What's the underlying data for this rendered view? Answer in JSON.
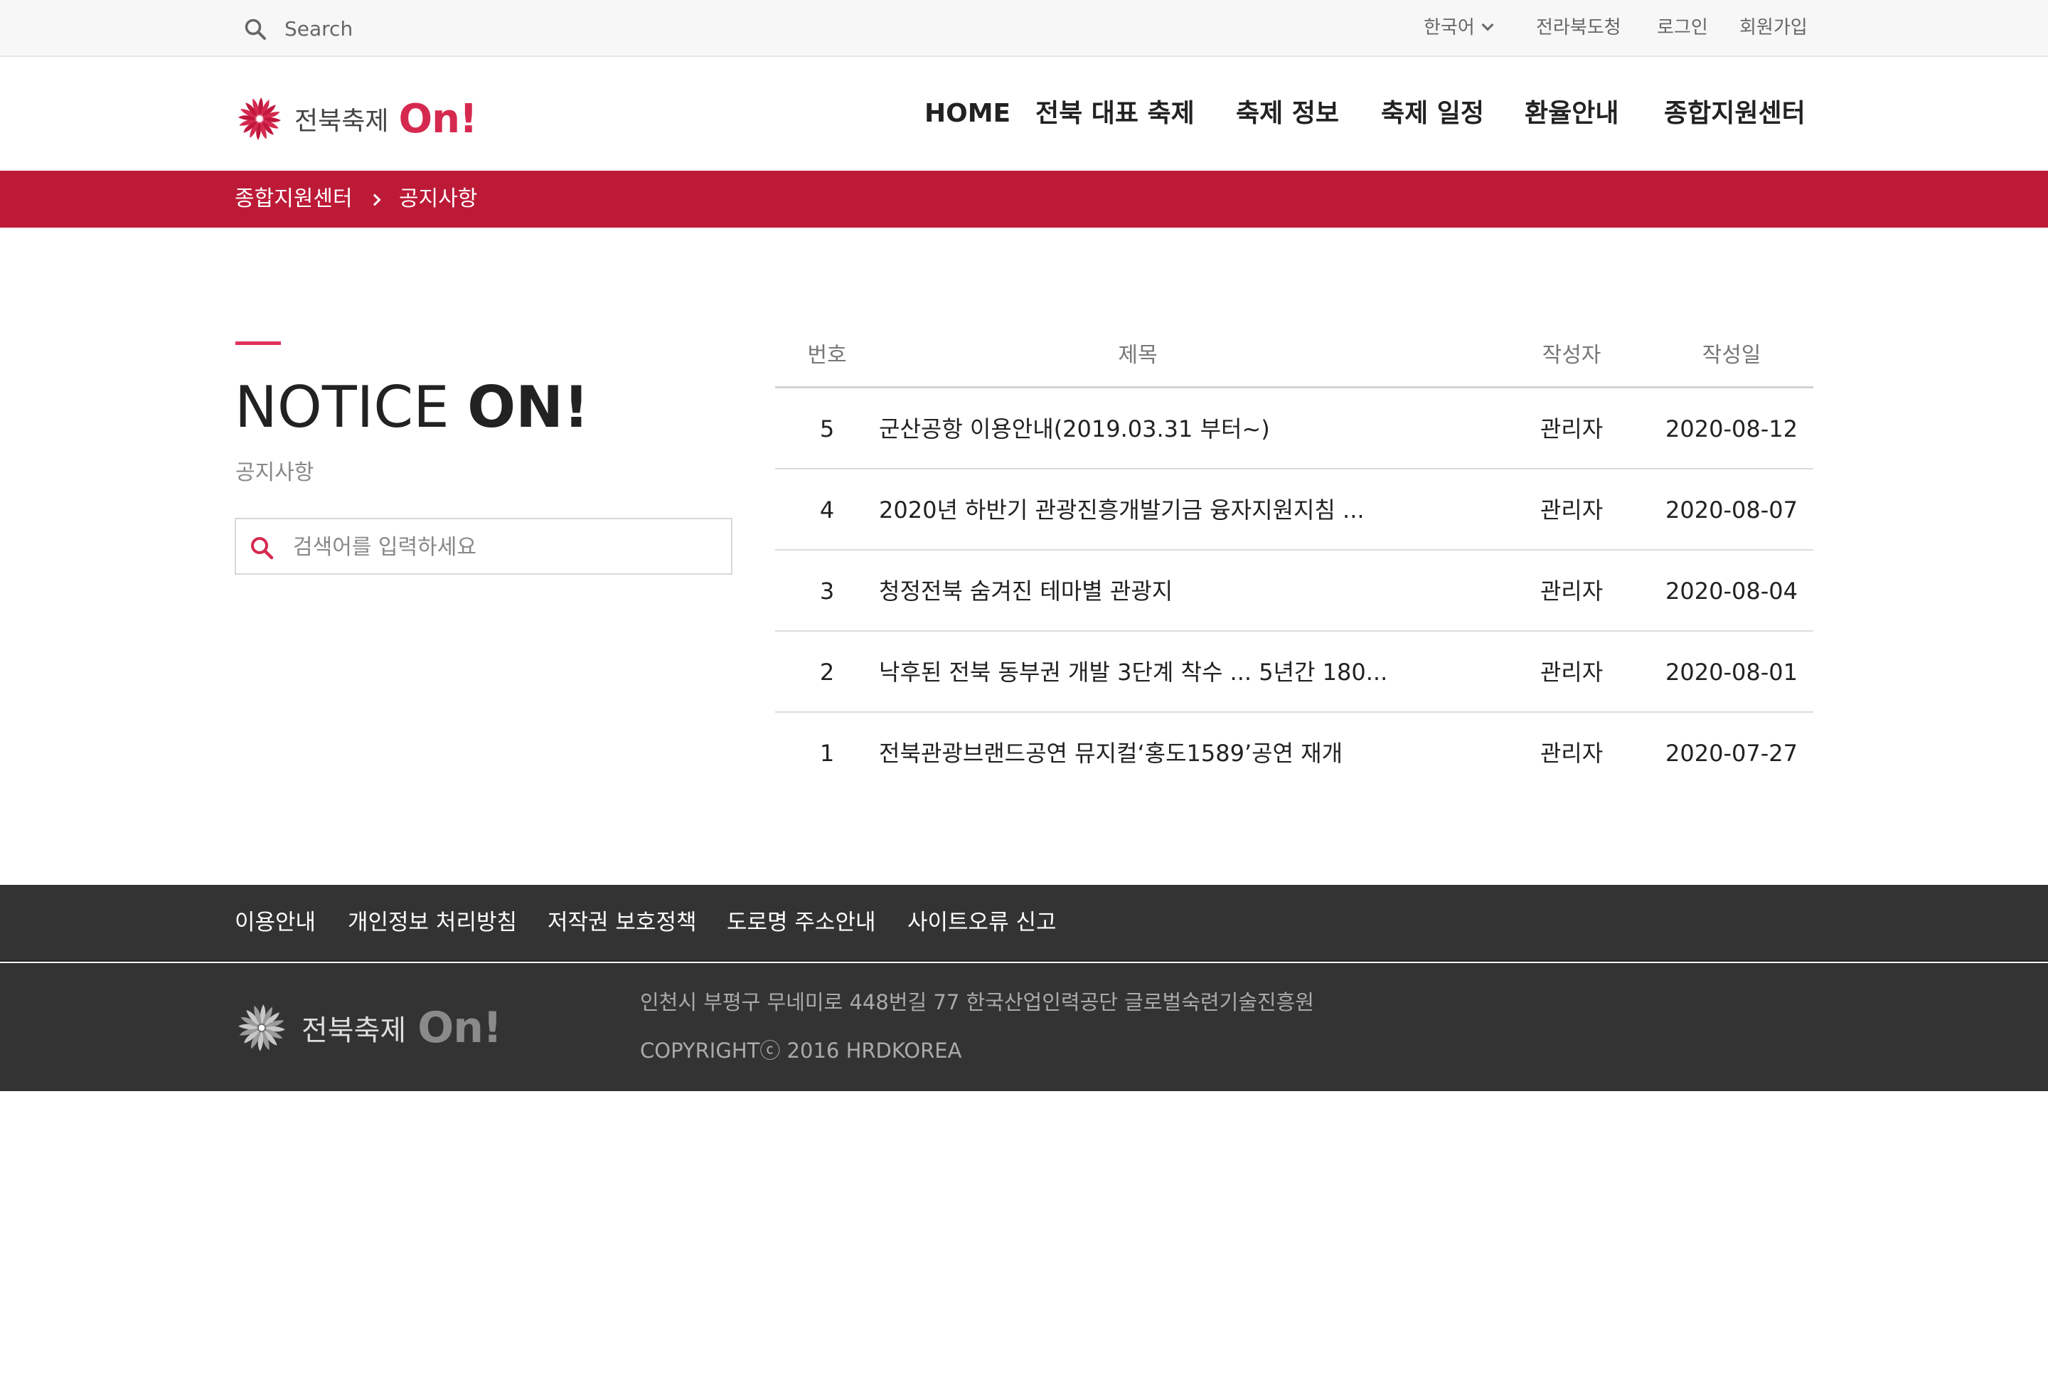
{
  "topbar": {
    "search_placeholder": "Search",
    "language": "한국어",
    "links": [
      "전라북도청",
      "로그인",
      "회원가입"
    ]
  },
  "header": {
    "logo_text": "전북축제",
    "logo_on": "On!",
    "nav": [
      "HOME",
      "전북 대표 축제",
      "축제 정보",
      "축제 일정",
      "환율안내",
      "종합지원센터"
    ]
  },
  "breadcrumb": [
    "종합지원센터",
    "공지사항"
  ],
  "page": {
    "heading_light": "NOTICE ",
    "heading_bold": "ON!",
    "subtitle": "공지사항",
    "search_placeholder": "검색어를 입력하세요"
  },
  "board": {
    "headers": [
      "번호",
      "제목",
      "작성자",
      "작성일"
    ],
    "rows": [
      {
        "num": "5",
        "title": "군산공항 이용안내(2019.03.31 부터~)",
        "author": "관리자",
        "date": "2020-08-12"
      },
      {
        "num": "4",
        "title": "2020년 하반기 관광진흥개발기금 융자지원지침 ...",
        "author": "관리자",
        "date": "2020-08-07"
      },
      {
        "num": "3",
        "title": "청정전북 숨겨진 테마별 관광지",
        "author": "관리자",
        "date": "2020-08-04"
      },
      {
        "num": "2",
        "title": "낙후된 전북 동부권 개발 3단계 착수 ... 5년간 180...",
        "author": "관리자",
        "date": "2020-08-01"
      },
      {
        "num": "1",
        "title": "전북관광브랜드공연 뮤지컬‘홍도1589’공연 재개",
        "author": "관리자",
        "date": "2020-07-27"
      }
    ]
  },
  "footer": {
    "links": [
      "이용안내",
      "개인정보 처리방침",
      "저작권 보호정책",
      "도로명 주소안내",
      "사이트오류 신고"
    ],
    "logo_text": "전북축제",
    "logo_on": "On!",
    "address": "인천시 부평구 무네미로 448번길 77 한국산업인력공단 글로벌숙련기술진흥원",
    "copyright": "COPYRIGHTⓒ 2016 HRDKOREA"
  },
  "colors": {
    "brand": "#bd1a38",
    "accent": "#d6294f",
    "footer_bg": "#333333",
    "topbar_bg": "#f7f7f7"
  },
  "icons": [
    "search-icon",
    "chevron-down-icon",
    "logo-flower-icon",
    "chevron-right-icon"
  ]
}
